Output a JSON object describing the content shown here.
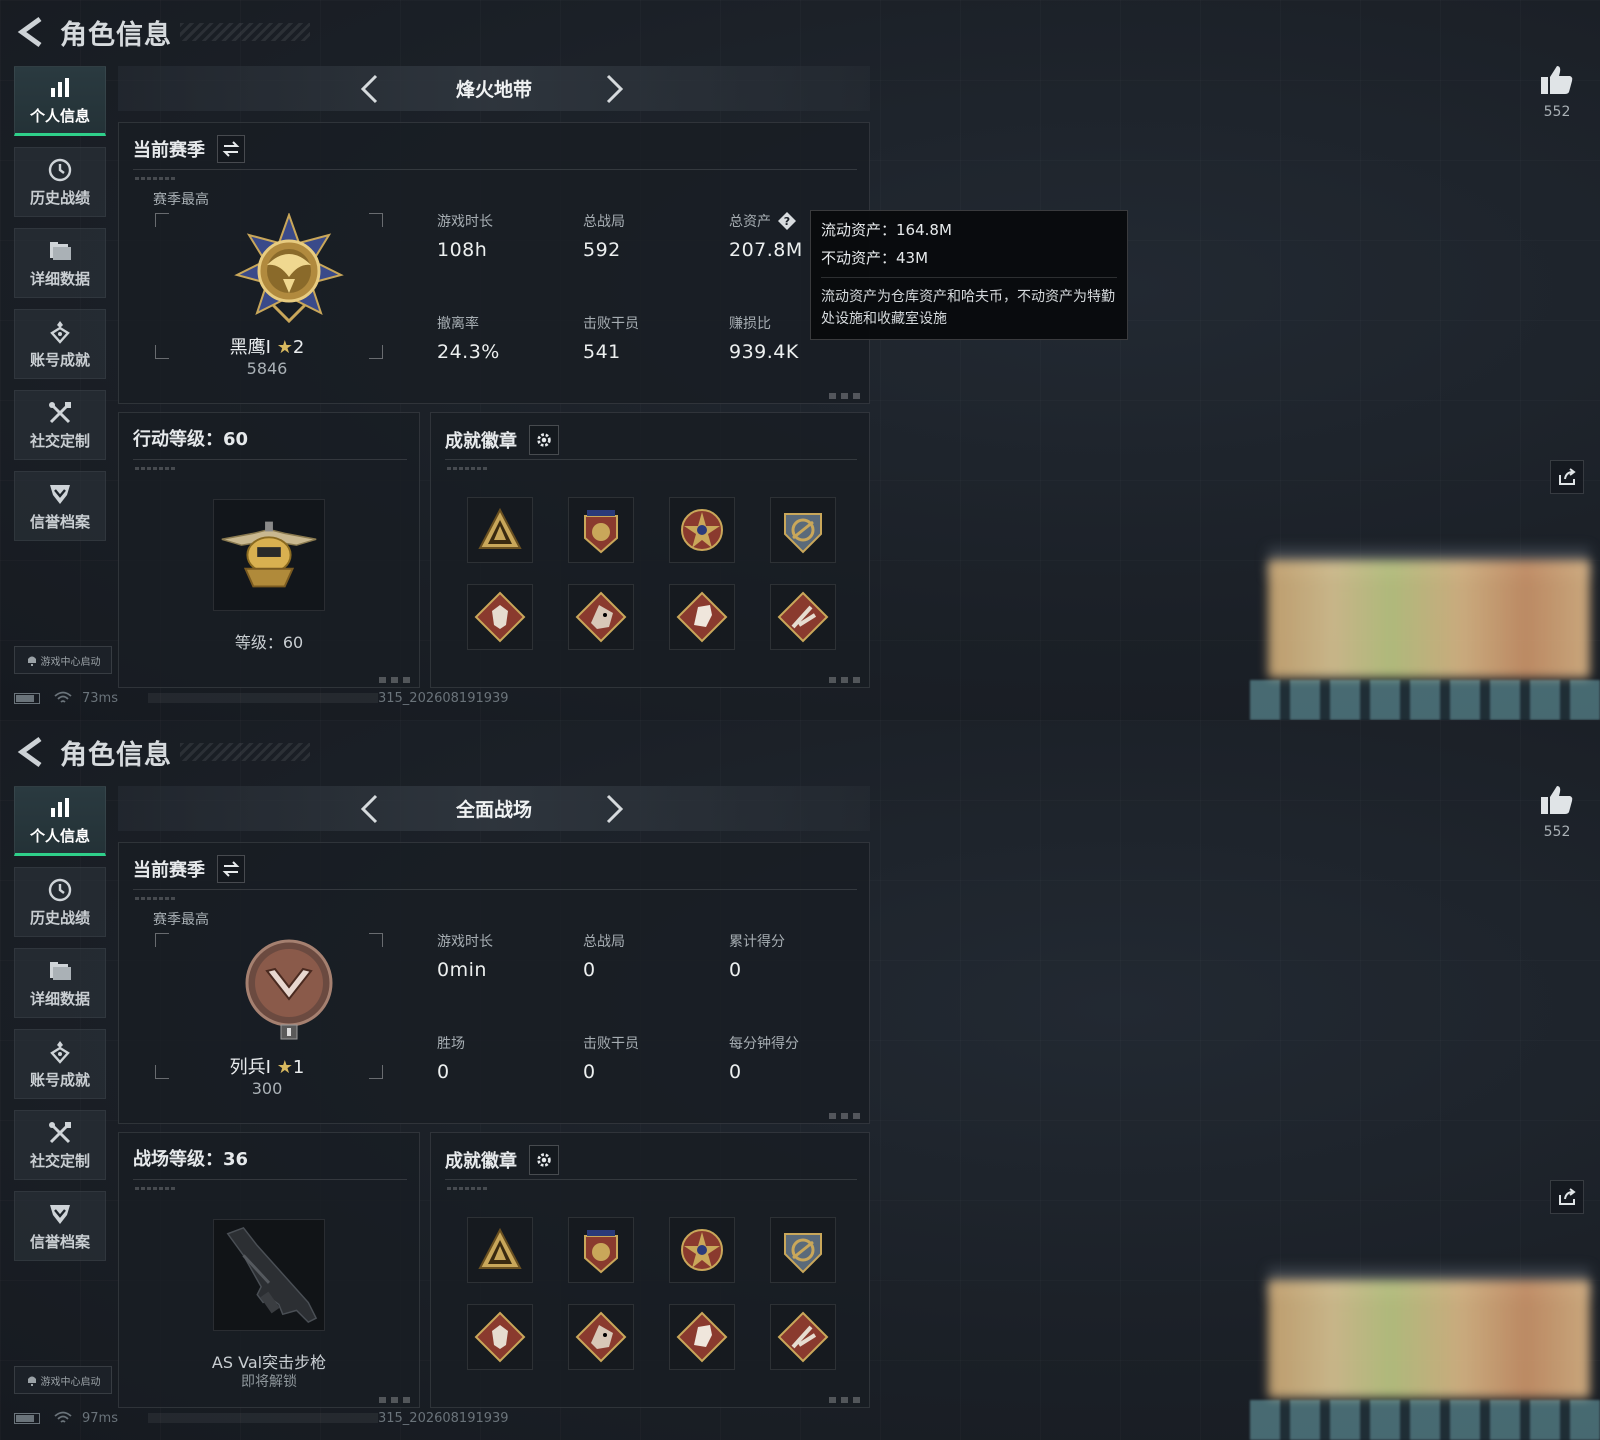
{
  "colors": {
    "accent_green": "#2fd08a",
    "gold": "#d9b95f",
    "bronze": "#8a4a3a"
  },
  "screens": [
    {
      "title": "角色信息",
      "sidebar": [
        {
          "label": "个人信息",
          "icon": "bar-chart-icon",
          "active": true
        },
        {
          "label": "历史战绩",
          "icon": "clock-icon"
        },
        {
          "label": "详细数据",
          "icon": "folder-icon"
        },
        {
          "label": "账号成就",
          "icon": "achievement-icon"
        },
        {
          "label": "社交定制",
          "icon": "tools-icon"
        },
        {
          "label": "信誉档案",
          "icon": "shield-check-icon"
        }
      ],
      "launch_badge": "游戏中心启动",
      "status": {
        "ping": "73ms",
        "build_id": "315_202608191939"
      },
      "mode_name": "烽火地带",
      "season": {
        "title": "当前赛季",
        "best_label": "赛季最高",
        "rank_name": "黑鹰Ⅰ",
        "rank_star": "★",
        "rank_stars": "2",
        "rank_score": "5846",
        "stats": [
          {
            "label": "游戏时长",
            "value": "108h"
          },
          {
            "label": "总战局",
            "value": "592"
          },
          {
            "label": "总资产",
            "value": "207.8M",
            "help": true
          },
          {
            "label": "撤离率",
            "value": "24.3%"
          },
          {
            "label": "击败干员",
            "value": "541"
          },
          {
            "label": "赚损比",
            "value": "939.4K"
          }
        ]
      },
      "tooltip": {
        "liquid": "流动资产：164.8M",
        "fixed": "不动资产：43M",
        "desc": "流动资产为仓库资产和哈夫币，不动资产为特勤处设施和收藏室设施"
      },
      "level": {
        "title": "行动等级：60",
        "caption": "等级：60",
        "sub": ""
      },
      "achievements": {
        "title": "成就徽章"
      },
      "like_count": "552"
    },
    {
      "title": "角色信息",
      "sidebar": [
        {
          "label": "个人信息",
          "icon": "bar-chart-icon",
          "active": true
        },
        {
          "label": "历史战绩",
          "icon": "clock-icon"
        },
        {
          "label": "详细数据",
          "icon": "folder-icon"
        },
        {
          "label": "账号成就",
          "icon": "achievement-icon"
        },
        {
          "label": "社交定制",
          "icon": "tools-icon"
        },
        {
          "label": "信誉档案",
          "icon": "shield-check-icon"
        }
      ],
      "launch_badge": "游戏中心启动",
      "status": {
        "ping": "97ms",
        "build_id": "315_202608191939"
      },
      "mode_name": "全面战场",
      "season": {
        "title": "当前赛季",
        "best_label": "赛季最高",
        "rank_name": "列兵Ⅰ",
        "rank_star": "★",
        "rank_stars": "1",
        "rank_score": "300",
        "stats": [
          {
            "label": "游戏时长",
            "value": "0min"
          },
          {
            "label": "总战局",
            "value": "0"
          },
          {
            "label": "累计得分",
            "value": "0"
          },
          {
            "label": "胜场",
            "value": "0"
          },
          {
            "label": "击败干员",
            "value": "0"
          },
          {
            "label": "每分钟得分",
            "value": "0"
          }
        ]
      },
      "level": {
        "title": "战场等级：36",
        "caption": "AS Val突击步枪",
        "sub": "即将解锁"
      },
      "achievements": {
        "title": "成就徽章"
      },
      "like_count": "552"
    }
  ]
}
